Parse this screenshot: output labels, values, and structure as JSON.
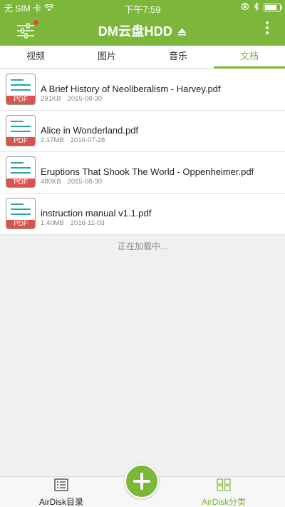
{
  "status_bar": {
    "carrier": "无 SIM 卡",
    "time": "下午7:59",
    "battery_level": 0.8,
    "wifi_icon": "wifi-icon",
    "lock_rotation_icon": "orientation-lock-icon",
    "bluetooth_icon": "bluetooth-icon"
  },
  "nav": {
    "title": "DM云盘HDD",
    "menu_icon": "sliders-icon",
    "more_icon": "more-vertical-icon"
  },
  "tabs": [
    {
      "label": "视频",
      "active": false
    },
    {
      "label": "图片",
      "active": false
    },
    {
      "label": "音乐",
      "active": false
    },
    {
      "label": "文档",
      "active": true
    }
  ],
  "files": [
    {
      "name": "A Brief History of Neoliberalism - Harvey.pdf",
      "size": "291KB",
      "date": "2015-08-30",
      "icon": "pdf-file-icon",
      "icon_label": "PDF"
    },
    {
      "name": "Alice in Wonderland.pdf",
      "size": "2.17MB",
      "date": "2016-07-28",
      "icon": "pdf-file-icon",
      "icon_label": "PDF"
    },
    {
      "name": "Eruptions That Shook The World - Oppenheimer.pdf",
      "size": "480KB",
      "date": "2015-08-30",
      "icon": "pdf-file-icon",
      "icon_label": "PDF"
    },
    {
      "name": "instruction manual v1.1.pdf",
      "size": "1.40MB",
      "date": "2016-11-03",
      "icon": "pdf-file-icon",
      "icon_label": "PDF"
    }
  ],
  "loading_text": "正在加载中...",
  "bottom_bar": {
    "left_label": "AirDisk目录",
    "right_label": "AirDisk分类",
    "add_icon": "plus-icon"
  },
  "colors": {
    "accent": "#7cb63b",
    "pdf_red": "#d9534f",
    "pdf_line": "#2aa5a0"
  }
}
